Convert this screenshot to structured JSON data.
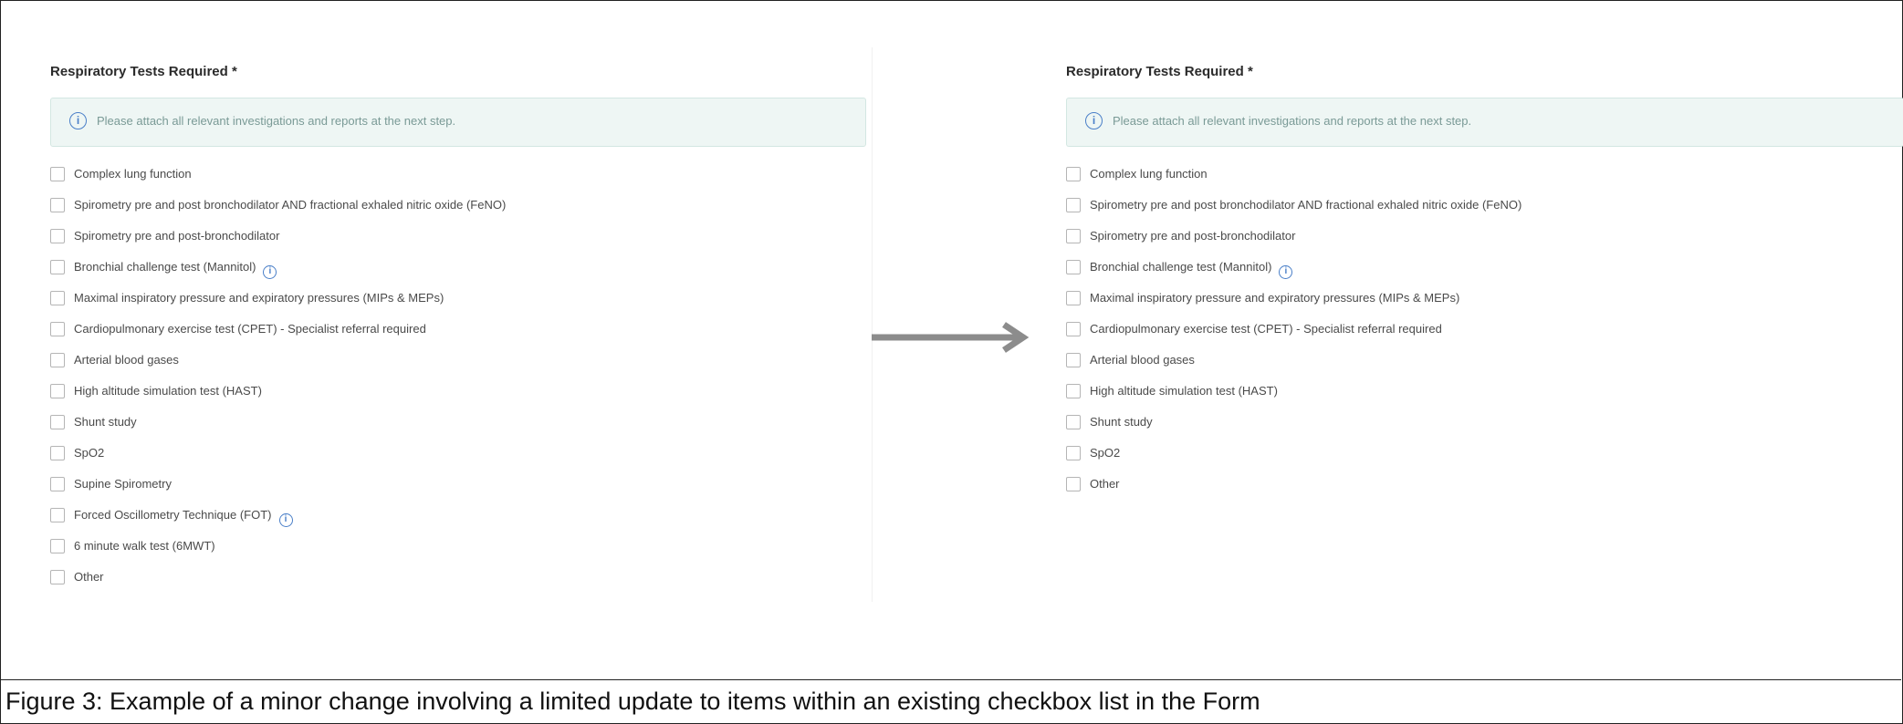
{
  "left_panel": {
    "title": "Respiratory Tests Required *",
    "info": "Please attach all relevant investigations and reports at the next step.",
    "items": [
      {
        "label": "Complex lung function",
        "info": false
      },
      {
        "label": "Spirometry pre and post bronchodilator AND fractional exhaled nitric oxide (FeNO)",
        "info": false
      },
      {
        "label": "Spirometry pre and post-bronchodilator",
        "info": false
      },
      {
        "label": "Bronchial challenge test (Mannitol)",
        "info": true
      },
      {
        "label": "Maximal inspiratory pressure and expiratory pressures (MIPs & MEPs)",
        "info": false
      },
      {
        "label": "Cardiopulmonary exercise test (CPET) - Specialist referral required",
        "info": false
      },
      {
        "label": "Arterial blood gases",
        "info": false
      },
      {
        "label": "High altitude simulation test (HAST)",
        "info": false
      },
      {
        "label": "Shunt study",
        "info": false
      },
      {
        "label": "SpO2",
        "info": false
      },
      {
        "label": "Supine Spirometry",
        "info": false
      },
      {
        "label": "Forced Oscillometry Technique (FOT)",
        "info": true
      },
      {
        "label": "6 minute walk test (6MWT)",
        "info": false
      },
      {
        "label": "Other",
        "info": false
      }
    ]
  },
  "right_panel": {
    "title": "Respiratory Tests Required *",
    "info": "Please attach all relevant investigations and reports at the next step.",
    "items": [
      {
        "label": "Complex lung function",
        "info": false
      },
      {
        "label": "Spirometry pre and post bronchodilator AND fractional exhaled nitric oxide (FeNO)",
        "info": false
      },
      {
        "label": "Spirometry pre and post-bronchodilator",
        "info": false
      },
      {
        "label": "Bronchial challenge test (Mannitol)",
        "info": true
      },
      {
        "label": "Maximal inspiratory pressure and expiratory pressures (MIPs & MEPs)",
        "info": false
      },
      {
        "label": "Cardiopulmonary exercise test (CPET) - Specialist referral required",
        "info": false
      },
      {
        "label": "Arterial blood gases",
        "info": false
      },
      {
        "label": "High altitude simulation test (HAST)",
        "info": false
      },
      {
        "label": "Shunt study",
        "info": false
      },
      {
        "label": "SpO2",
        "info": false
      },
      {
        "label": "Other",
        "info": false
      }
    ]
  },
  "icons": {
    "info": "info-icon",
    "arrow": "arrow-right-icon"
  },
  "colors": {
    "info_bg": "#eef6f4",
    "info_icon": "#4a7fc8",
    "arrow": "#8c8c8c"
  },
  "caption": "Figure 3: Example of a minor change involving a limited update to items within an existing checkbox list in the Form"
}
